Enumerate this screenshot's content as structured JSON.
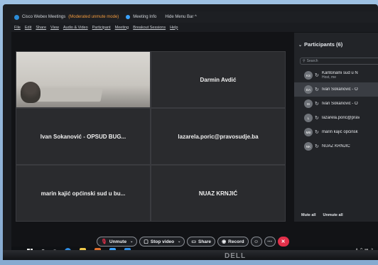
{
  "titlebar": {
    "app_name": "Cisco Webex Meetings",
    "state": "(Moderated unmute mode)",
    "meeting_info": "Meeting Info",
    "hide_menu": "Hide Menu Bar ^"
  },
  "menu": [
    "File",
    "Edit",
    "Share",
    "View",
    "Audio & Video",
    "Participant",
    "Meeting",
    "Breakout Sessions",
    "Help"
  ],
  "tiles": {
    "camera_label": "",
    "t1": "Darmin Avdić",
    "t2": "Ivan Sokanović - OPSUD BUG...",
    "t3": "lazarela.poric@pravosudje.ba",
    "t4": "marin kajić općinski sud u bu...",
    "t5": "NUAZ KRNJIĆ"
  },
  "panel": {
    "header": "Participants (6)",
    "search_placeholder": "Search",
    "participants": [
      {
        "initials": "KS",
        "name": "Kantonalni sud u N",
        "sub": "Host, me",
        "active": false
      },
      {
        "initials": "DA",
        "name": "Ivan Sokanović - O",
        "sub": "",
        "active": true
      },
      {
        "initials": "IS",
        "name": "Ivan Sokanović - O",
        "sub": "",
        "active": false
      },
      {
        "initials": "L",
        "name": "lazarela.poric@prav",
        "sub": "",
        "active": false
      },
      {
        "initials": "MB",
        "name": "marin kajić općinsk",
        "sub": "",
        "active": false
      },
      {
        "initials": "NK",
        "name": "NUAZ KRNJIĆ",
        "sub": "",
        "active": false
      }
    ],
    "mute_all": "Mute all",
    "unmute_all": "Unmute all"
  },
  "controls": {
    "unmute": "Unmute",
    "stop_video": "Stop video",
    "share": "Share",
    "record": "Record"
  },
  "monitor_brand": "DELL",
  "colors": {
    "leave": "#e2304a",
    "state": "#f19a3e",
    "accent": "#3aa3ff"
  }
}
